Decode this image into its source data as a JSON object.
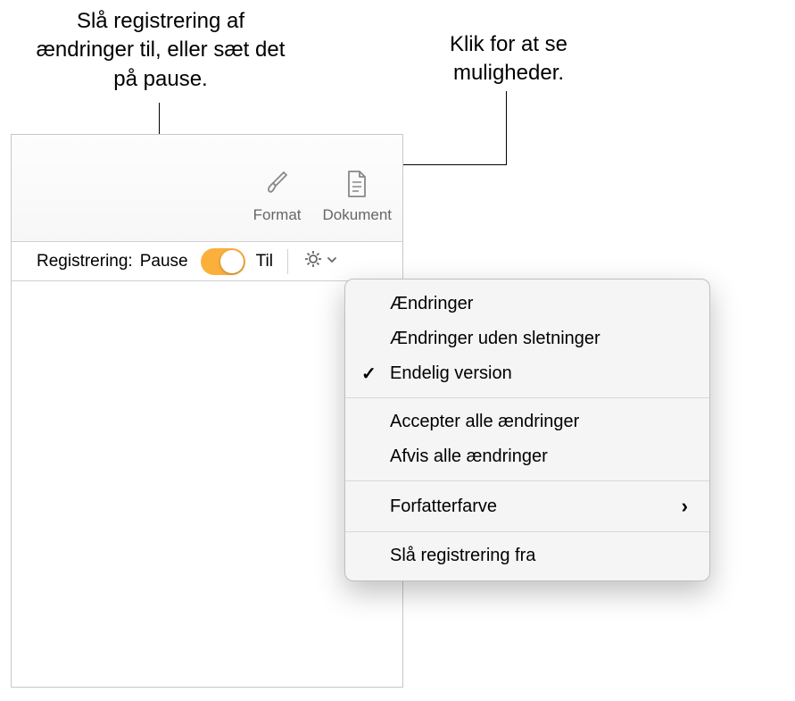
{
  "callouts": {
    "left": "Slå registrering af ændringer til, eller sæt det på pause.",
    "right": "Klik for at se muligheder."
  },
  "toolbar": {
    "format_label": "Format",
    "document_label": "Dokument"
  },
  "tracking": {
    "label": "Registrering:",
    "pause_label": "Pause",
    "on_label": "Til"
  },
  "menu": {
    "changes": "Ændringer",
    "changes_without_deletions": "Ændringer uden sletninger",
    "final_version": "Endelig version",
    "accept_all": "Accepter alle ændringer",
    "reject_all": "Afvis alle ændringer",
    "author_color": "Forfatterfarve",
    "turn_off": "Slå registrering fra"
  }
}
